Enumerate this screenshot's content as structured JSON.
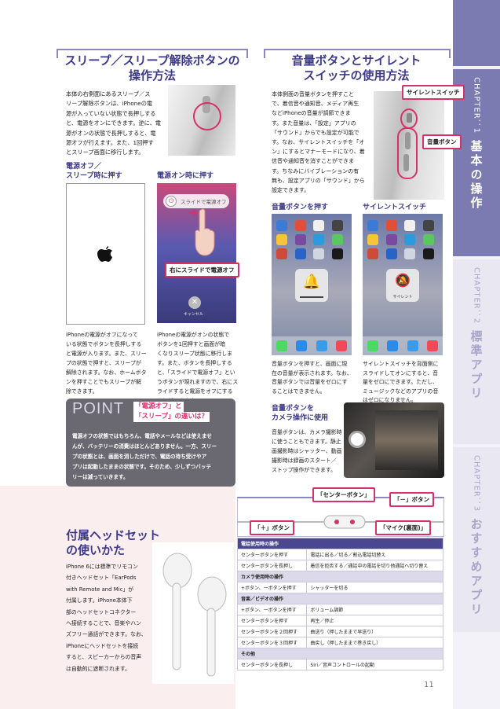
{
  "chapters": [
    {
      "number": "CHAPTER：1",
      "title": "基本の操作",
      "active": true
    },
    {
      "number": "CHAPTER：2",
      "title": "標準アプリ",
      "active": false
    },
    {
      "number": "CHAPTER：3",
      "title": "おすすめアプリ",
      "active": false
    }
  ],
  "sleep": {
    "title_line1": "スリープ／スリープ解除ボタンの",
    "title_line2": "操作方法",
    "body": [
      "本体の右側面にあるスリープ／ス",
      "リープ解除ボタンは、iPhoneの電",
      "源が入っていない状態で長押しする",
      "と、電源をオンにできます。逆に、電",
      "源がオンの状態で長押しすると、電",
      "源オフが行えます。また、1回押す",
      "とスリープ画面に移行します。"
    ],
    "off_heading_line1": "電源オフ／",
    "off_heading_line2": "スリープ時に押す",
    "on_heading": "電源オン時に押す",
    "slide_text": "スライドで電源オフ",
    "cancel_text": "キャンセル",
    "slide_callout": "右にスライドで電源オフ",
    "caption_off": [
      "iPhoneの電源がオフになって",
      "いる状態でボタンを長押しする",
      "と電源が入ります。また、スリー",
      "プの状態で押すと、スリープが",
      "解除されます。なお、ホームボタ",
      "ンを押すことでもスリープが解",
      "除できます。"
    ],
    "caption_on": [
      "iPhoneの電源がオンの状態で",
      "ボタンを1回押すと画面が暗",
      "くなりスリープ状態に移行しま",
      "す。また、ボタンを長押しする",
      "と、「スライドで電源オフ」とい",
      "うボタンが現れますので、右にス",
      "ライドすると電源をオフにする",
      "ことができます。"
    ]
  },
  "point": {
    "logo": "POINT",
    "title_line1": "「電源オフ」と",
    "title_line2": "「スリープ」の違いは？",
    "body": [
      "電源オフの状態ではもちろん、電話やメールなどは使えませ",
      "んが、バッテリーの消費はほとんどありません。一方、スリー",
      "プの状態とは、画面を消しただけで、電話の待ち受けやア",
      "プリは起動したままの状態です。そのため、少しずつバッテ",
      "リーは減っていきます。"
    ]
  },
  "volume": {
    "title_line1": "音量ボタンとサイレント",
    "title_line2": "スイッチの使用方法",
    "body": [
      "本体側面の音量ボタンを押すこと",
      "で、着信音や通知音、メディア再生",
      "などiPhoneの音量が調節できま",
      "す。また音量は、「設定」アプリの",
      "「サウンド」からでも設定が可能で",
      "す。なお、サイレントスイッチを「オ",
      "ン」にするとマナーモードになり、着",
      "信音や通知音を消すことができま",
      "す。ちなみにバイブレーションの有",
      "無も、設定アプリの「サウンド」から",
      "設定できます。"
    ],
    "silent_callout": "サイレントスイッチ",
    "volume_callout": "音量ボタン",
    "vol_heading": "音量ボタンを押す",
    "silent_heading": "サイレントスイッチ",
    "silent_hud": "サイレント",
    "caption_vol": [
      "音量ボタンを押すと、画面に現",
      "在の音量が表示されます。なお、",
      "音量ボタンでは音量をゼロにす",
      "ることはできません。"
    ],
    "caption_silent": [
      "サイレントスイッチを背面側に",
      "スライドしてオンにすると、音",
      "量をゼロにできます。ただし、",
      "ミュージックなどのアプリの音",
      "はゼロになりません。"
    ],
    "camera_heading_line1": "音量ボタンを",
    "camera_heading_line2": "カメラ操作に使用",
    "camera_body": [
      "音量ボタンは、カメラ撮影時",
      "に使うこともできます。静止",
      "画撮影時はシャッター、動画",
      "撮影時は録画のスタート／",
      "ストップ操作ができます。"
    ]
  },
  "headset": {
    "title_line1": "付属ヘッドセット",
    "title_line2": "の使いかた",
    "body": [
      "iPhone 6には標準でリモコン",
      "付きヘッドセット「EarPods",
      "with Remote and Mic」が",
      "付属します。iPhone本体下",
      "部のヘッドセットコネクター",
      "へ接続することで、音楽やハン",
      "ズフリー通話ができます。なお、",
      "iPhoneにヘッドセットを接続",
      "すると、スピーカーからの音声",
      "は自動的に遮断されます。"
    ],
    "labels": {
      "center": "「センターボタン」",
      "minus": "「－」ボタン",
      "plus": "「＋」ボタン",
      "mic": "「マイク(裏面)」"
    }
  },
  "ops_table": [
    {
      "kind": "head",
      "text": "電話使用時の操作"
    },
    {
      "kind": "row",
      "action": "センターボタンを押す",
      "result": "電話に出る／切る／割込電話切替え"
    },
    {
      "kind": "row",
      "action": "センターボタンを長押し",
      "result": "着信を拒否する／通話中の電話を切り他通話へ切り替え"
    },
    {
      "kind": "cat",
      "text": "カメラ使用時の操作"
    },
    {
      "kind": "row",
      "action": "+ボタン、ーボタンを押す",
      "result": "シャッターを切る"
    },
    {
      "kind": "cat",
      "text": "音楽／ビデオの操作"
    },
    {
      "kind": "row",
      "action": "+ボタン、ーボタンを押す",
      "result": "ボリューム調節"
    },
    {
      "kind": "row",
      "action": "センターボタンを押す",
      "result": "再生／停止"
    },
    {
      "kind": "row",
      "action": "センターボタンを２回押す",
      "result": "曲送り（押したままで早送り）"
    },
    {
      "kind": "row",
      "action": "センターボタンを３回押す",
      "result": "曲戻し（押したままで巻き戻し）"
    },
    {
      "kind": "cat",
      "text": "その他"
    },
    {
      "kind": "row",
      "action": "センターボタンを長押し",
      "result": "Siri／音声コントロールの起動"
    }
  ],
  "page_number": "11",
  "colors": {
    "accent": "#7b7bb2",
    "title": "#3e3a8a",
    "callout": "#d7306a",
    "point_bg": "#6a6870"
  }
}
